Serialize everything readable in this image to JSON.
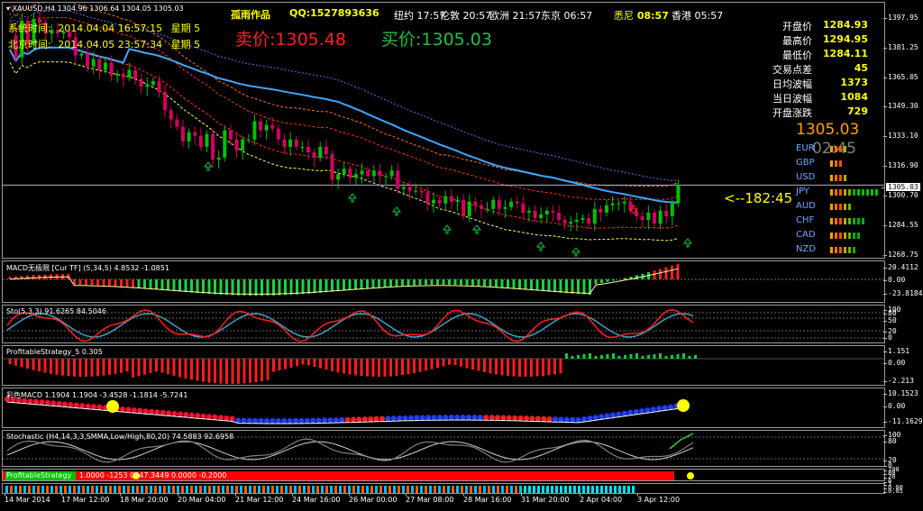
{
  "chart": {
    "symbol": "XAUUSD,H4",
    "ohlc": "1304.96 1306.64 1304.05 1305.03"
  },
  "server": {
    "label": "系统时间:",
    "value": "2014.04.04 16:57:15",
    "weekday": "星期 5"
  },
  "local": {
    "label": "北京时间:",
    "value": "2014.04.05 23:57:34",
    "weekday": "星期 5"
  },
  "brand": {
    "text": "孤雨作品",
    "qq": "QQ:1527893636"
  },
  "clocks": [
    {
      "city": "纽约",
      "time": "17:57"
    },
    {
      "city": "伦敦",
      "time": "20:57"
    },
    {
      "city": "欧洲",
      "time": "21:57"
    },
    {
      "city": "东京",
      "time": "06:57"
    },
    {
      "city": "悉尼",
      "time": "08:57"
    },
    {
      "city": "香港",
      "time": "05:57"
    }
  ],
  "quote": {
    "sell_label": "卖价:",
    "sell": "1305.48",
    "buy_label": "买价:",
    "buy": "1305.03",
    "big_price": "1305.03",
    "countdown_gray": "02:45",
    "countdown_arrow": "<--182:45",
    "price_tag": "1305.03"
  },
  "stats": [
    {
      "k": "开盘价",
      "v": "1284.93"
    },
    {
      "k": "最高价",
      "v": "1294.95"
    },
    {
      "k": "最低价",
      "v": "1284.11"
    },
    {
      "k": "交易点差",
      "v": "45"
    },
    {
      "k": "日均波幅",
      "v": "1373"
    },
    {
      "k": "当日波幅",
      "v": "1084"
    },
    {
      "k": "开盘涨跌",
      "v": "729"
    }
  ],
  "currencies": [
    {
      "name": "EUR",
      "bars": 4
    },
    {
      "name": "GBP",
      "bars": 3
    },
    {
      "name": "USD",
      "bars": 4
    },
    {
      "name": "JPY",
      "bars": 11
    },
    {
      "name": "AUD",
      "bars": 5
    },
    {
      "name": "CHF",
      "bars": 8
    },
    {
      "name": "CAD",
      "bars": 7
    },
    {
      "name": "NZD",
      "bars": 6
    }
  ],
  "indicators": {
    "macd": {
      "title": "MACD无极限 [Cur TF] (5,34,5) 4.8532 -1.0851",
      "ticks": [
        "20.4112",
        "0.00",
        "-23.8184"
      ]
    },
    "sto": {
      "title": "Sto(5,3,3) 91.6265 84.5046",
      "ticks": [
        "100",
        "80",
        "50",
        "20",
        "0"
      ]
    },
    "ps5": {
      "title": "ProfitableStrategy_5 0.305",
      "ticks": [
        "1.151",
        "0.00",
        "-2.213"
      ]
    },
    "macd2": {
      "title": "彩色MACD 1.1904 1.1904 -3.4528 -1.1814 -5.7241",
      "ticks": [
        "10.1523",
        "0.00",
        "-11.1629"
      ]
    },
    "stoch": {
      "title": "Stochastic (H4,14,3,3,SMMA,Low/High,80,20) 74.5883 92.6958",
      "ticks": [
        "100",
        "80",
        "20",
        "0"
      ]
    },
    "ps": {
      "title": "ProfitableStrategy",
      "values": "1.0000 -1253 0247.3449 0.0000 -0.2000",
      "ticks": [
        "100",
        "80",
        "20",
        "0"
      ]
    },
    "bottom": {
      "ticks": [
        "1",
        "0.00",
        "0.05"
      ]
    }
  },
  "price_axis": [
    "1397.95",
    "1381.25",
    "1365.05",
    "1349.30",
    "1333.10",
    "1316.90",
    "1300.70",
    "1284.55",
    "1268.75"
  ],
  "time_axis": [
    "14 Mar 2014",
    "17 Mar 12:00",
    "18 Mar 20:00",
    "20 Mar 04:00",
    "21 Mar 12:00",
    "24 Mar 16:00",
    "26 Mar 00:00",
    "27 Mar 08:00",
    "28 Mar 16:00",
    "31 Mar 20:00",
    "2 Apr 04:00",
    "3 Apr 12:00"
  ],
  "colors": {
    "up": "#00c000",
    "down": "#d40060",
    "ma": "#3fa6ff",
    "price_line": "#b0b0c8",
    "green": "#00d060",
    "red": "#ff1d1d"
  },
  "candles": [
    1387,
    1375,
    1395,
    1382,
    1396,
    1394,
    1388,
    1390,
    1388,
    1389,
    1386,
    1376,
    1377,
    1370,
    1374,
    1368,
    1372,
    1365,
    1366,
    1364,
    1368,
    1363,
    1359,
    1360,
    1362,
    1356,
    1346,
    1341,
    1337,
    1329,
    1334,
    1332,
    1326,
    1333,
    1319,
    1320,
    1335,
    1330,
    1324,
    1330,
    1330,
    1340,
    1335,
    1338,
    1336,
    1330,
    1326,
    1330,
    1326,
    1326,
    1323,
    1320,
    1326,
    1322,
    1308,
    1311,
    1314,
    1309,
    1311,
    1313,
    1310,
    1313,
    1310,
    1310,
    1313,
    1303,
    1304,
    1302,
    1302,
    1301,
    1295,
    1297,
    1295,
    1299,
    1296,
    1297,
    1288,
    1296,
    1294,
    1292,
    1292,
    1297,
    1292,
    1293,
    1296,
    1295,
    1290,
    1291,
    1287,
    1289,
    1291,
    1290,
    1286,
    1284,
    1285,
    1286,
    1287,
    1284,
    1292,
    1290,
    1294,
    1295,
    1295,
    1296,
    1291,
    1288,
    1286,
    1290,
    1284,
    1291,
    1288,
    1295,
    1305
  ]
}
